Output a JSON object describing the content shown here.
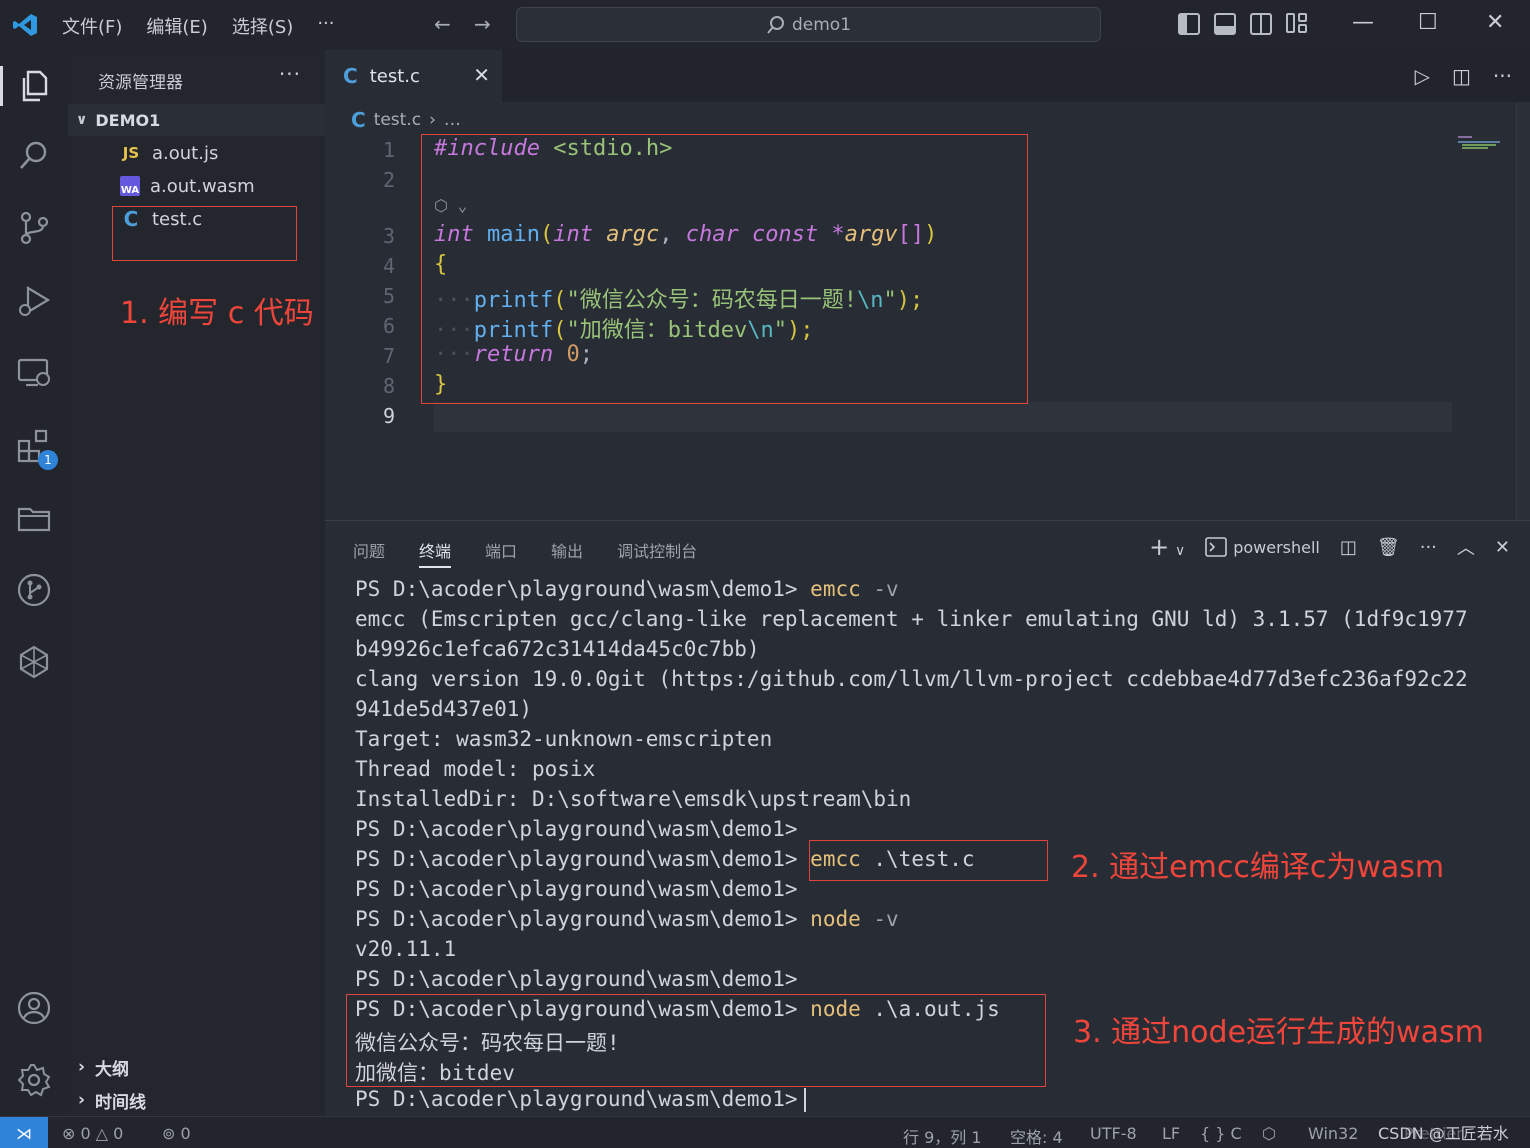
{
  "menu": {
    "file": "文件(F)",
    "edit": "编辑(E)",
    "select": "选择(S)",
    "more": "···"
  },
  "search": {
    "text": "demo1"
  },
  "sidebar": {
    "title": "资源管理器",
    "more": "···",
    "folder": "DEMO1",
    "files": [
      {
        "icon": "JS",
        "name": "a.out.js"
      },
      {
        "icon": "WA",
        "name": "a.out.wasm"
      },
      {
        "icon": "C",
        "name": "test.c"
      }
    ],
    "outline": "大纲",
    "timeline": "时间线"
  },
  "activity": {
    "extensions_badge": "1"
  },
  "editor": {
    "tab_label": "test.c",
    "tab_close": "✕",
    "breadcrumb_file": "test.c",
    "breadcrumb_rest": "…",
    "line_numbers": [
      "1",
      "2",
      "3",
      "4",
      "5",
      "6",
      "7",
      "8",
      "9"
    ]
  },
  "code": {
    "l1_kw": "#include",
    "l1_hdr": " <stdio.h>",
    "l3_int": "int",
    "l3_main": "main",
    "l3_open": "(",
    "l3_int2": "int",
    "l3_argc": " argc",
    "l3_comma": ", ",
    "l3_char": "char const",
    "l3_star": " *",
    "l3_argv": "argv",
    "l3_brk": "[]",
    "l3_close": ")",
    "l4": "{",
    "l5_fn": "printf",
    "l5_open": "(",
    "l5_str": "\"微信公众号：码农每日一题!",
    "l5_esc": "\\n",
    "l5_end": "\"",
    "l5_close": ");",
    "l6_fn": "printf",
    "l6_open": "(",
    "l6_str": "\"加微信：bitdev",
    "l6_esc": "\\n",
    "l6_end": "\"",
    "l6_close": ");",
    "l7_ret": "return",
    "l7_num": " 0",
    "l7_semi": ";",
    "l8": "}"
  },
  "annotations": {
    "a1": "1. 编写 c 代码",
    "a2": "2. 通过emcc编译c为wasm",
    "a3": "3. 通过node运行生成的wasm"
  },
  "panel": {
    "tabs": [
      "问题",
      "终端",
      "端口",
      "输出",
      "调试控制台"
    ],
    "add": "+",
    "shell": "powershell"
  },
  "terminal": {
    "prompt": "PS D:\\acoder\\playground\\wasm\\demo1>",
    "cmd_emcc": "emcc",
    "arg_v": " -v",
    "emcc_out1": "emcc (Emscripten gcc/clang-like replacement + linker emulating GNU ld) 3.1.57 (1df9c1977",
    "emcc_out2": "b49926c1efca672c31414da45c0c7bb)",
    "clang_out1": "clang version 19.0.0git (https:/github.com/llvm/llvm-project ccdebbae4d77d3efc236af92c22",
    "clang_out2": "941de5d437e01)",
    "target": "Target: wasm32-unknown-emscripten",
    "thread": "Thread model: posix",
    "installed": "InstalledDir: D:\\software\\emsdk\\upstream\\bin",
    "arg_test": " .\\test.c",
    "cmd_node": "node",
    "node_version": "v20.11.1",
    "arg_js": " .\\a.out.js",
    "out1": "微信公众号：码农每日一题!",
    "out2": "加微信：bitdev"
  },
  "status": {
    "errors": "0",
    "warnings": "0",
    "ports": "0",
    "position": "行 9，列 1",
    "spaces": "空格: 4",
    "encoding": "UTF-8",
    "eol": "LF",
    "language": "{ } C",
    "platform": "Win32",
    "formatter": "Prettier",
    "watermark": "CSDN @工匠若水"
  },
  "colors": {
    "accent": "#2f83d8",
    "annotation": "#e0443c",
    "editor_bg": "#282c34",
    "sidebar_bg": "#23262d"
  }
}
